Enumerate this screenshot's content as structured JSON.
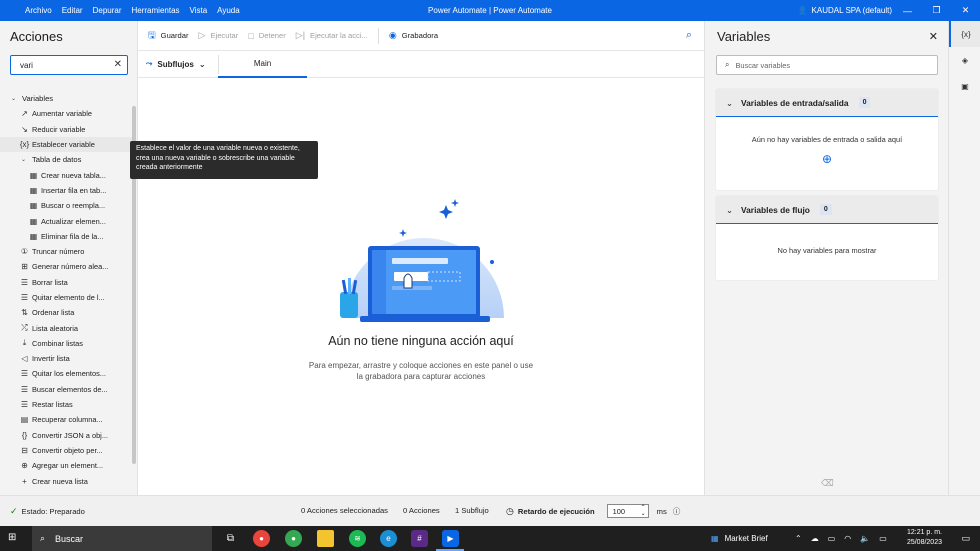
{
  "titlebar": {
    "menu": [
      "Archivo",
      "Editar",
      "Depurar",
      "Herramientas",
      "Vista",
      "Ayuda"
    ],
    "title": "Power Automate | Power Automate",
    "account": "KAUDAL SPA (default)"
  },
  "actions": {
    "title": "Acciones",
    "search_value": "vari",
    "tree": [
      {
        "kind": "group",
        "label": "Variables"
      },
      {
        "kind": "item",
        "icon": "increase-icon",
        "glyph": "↗",
        "label": "Aumentar variable"
      },
      {
        "kind": "item",
        "icon": "decrease-icon",
        "glyph": "↘",
        "label": "Reducir variable"
      },
      {
        "kind": "item",
        "icon": "variable-icon",
        "glyph": "{x}",
        "label": "Establecer variable",
        "highlight": true
      },
      {
        "kind": "subgroup",
        "label": "Tabla de datos"
      },
      {
        "kind": "item2",
        "icon": "table-icon",
        "glyph": "▦",
        "label": "Crear nueva tabla..."
      },
      {
        "kind": "item2",
        "icon": "table-icon",
        "glyph": "▦",
        "label": "Insertar fila en tab..."
      },
      {
        "kind": "item2",
        "icon": "table-icon",
        "glyph": "▦",
        "label": "Buscar o reempla..."
      },
      {
        "kind": "item2",
        "icon": "table-icon",
        "glyph": "▦",
        "label": "Actualizar elemen..."
      },
      {
        "kind": "item2",
        "icon": "table-icon",
        "glyph": "▦",
        "label": "Eliminar fila de la..."
      },
      {
        "kind": "item",
        "icon": "number-icon",
        "glyph": "①",
        "label": "Truncar número"
      },
      {
        "kind": "item",
        "icon": "random-icon",
        "glyph": "⊞",
        "label": "Generar número alea..."
      },
      {
        "kind": "item",
        "icon": "list-icon",
        "glyph": "☰",
        "label": "Borrar lista"
      },
      {
        "kind": "item",
        "icon": "list-icon",
        "glyph": "☰",
        "label": "Quitar elemento de l..."
      },
      {
        "kind": "item",
        "icon": "sort-icon",
        "glyph": "⇅",
        "label": "Ordenar lista"
      },
      {
        "kind": "item",
        "icon": "shuffle-icon",
        "glyph": "⤮",
        "label": "Lista aleatoria"
      },
      {
        "kind": "item",
        "icon": "merge-icon",
        "glyph": "⤓",
        "label": "Combinar listas"
      },
      {
        "kind": "item",
        "icon": "reverse-icon",
        "glyph": "◁",
        "label": "Invertir lista"
      },
      {
        "kind": "item",
        "icon": "list-icon",
        "glyph": "☰",
        "label": "Quitar los elementos..."
      },
      {
        "kind": "item",
        "icon": "list-icon",
        "glyph": "☰",
        "label": "Buscar elementos de..."
      },
      {
        "kind": "item",
        "icon": "list-icon",
        "glyph": "☰",
        "label": "Restar listas"
      },
      {
        "kind": "item",
        "icon": "column-icon",
        "glyph": "▤",
        "label": "Recuperar columna..."
      },
      {
        "kind": "item",
        "icon": "json-icon",
        "glyph": "{}",
        "label": "Convertir JSON a obj..."
      },
      {
        "kind": "item",
        "icon": "convert-icon",
        "glyph": "⊟",
        "label": "Convertir objeto per..."
      },
      {
        "kind": "item",
        "icon": "add-item-icon",
        "glyph": "⊕",
        "label": "Agregar un element..."
      },
      {
        "kind": "item",
        "icon": "plus-icon",
        "glyph": "+",
        "label": "Crear nueva lista"
      }
    ]
  },
  "tooltip": "Establece el valor de una variable nueva o existente, crea una nueva variable o sobrescribe una variable creada anteriormente",
  "toolbar": {
    "save": "Guardar",
    "run": "Ejecutar",
    "stop": "Detener",
    "step": "Ejecutar la acci...",
    "recorder": "Grabadora"
  },
  "tabs": {
    "subflows": "Subflujos",
    "main": "Main"
  },
  "canvas": {
    "empty_title": "Aún no tiene ninguna acción aquí",
    "empty_sub": "Para empezar, arrastre y coloque acciones en este panel o use la grabadora para capturar acciones"
  },
  "variables": {
    "title": "Variables",
    "search_placeholder": "Buscar variables",
    "io_title": "Variables de entrada/salida",
    "io_count": "0",
    "io_empty": "Aún no hay variables de entrada o salida aquí",
    "flow_title": "Variables de flujo",
    "flow_count": "0",
    "flow_empty": "No hay variables para mostrar"
  },
  "status": {
    "state": "Estado: Preparado",
    "selected": "0 Acciones seleccionadas",
    "actions": "0 Acciones",
    "subflows": "1 Subflujo",
    "delay_label": "Retardo de ejecución",
    "delay_value": "100",
    "unit": "ms"
  },
  "taskbar": {
    "search": "Buscar",
    "widget": "Market Brief",
    "time": "12:21 p. m.",
    "date": "25/08/2023"
  },
  "colors": {
    "accent": "#0b66e4",
    "ok": "#107c10"
  }
}
